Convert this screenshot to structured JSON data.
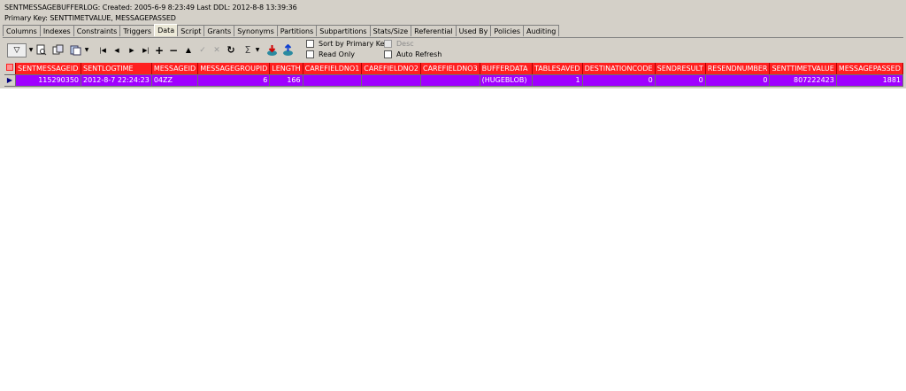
{
  "info": {
    "line1": "SENTMESSAGEBUFFERLOG:  Created: 2005-6-9 8:23:49   Last DDL: 2012-8-8 13:39:36",
    "line2": "Primary Key:  SENTTIMETVALUE, MESSAGEPASSED"
  },
  "tabs": [
    "Columns",
    "Indexes",
    "Constraints",
    "Triggers",
    "Data",
    "Script",
    "Grants",
    "Synonyms",
    "Partitions",
    "Subpartitions",
    "Stats/Size",
    "Referential",
    "Used By",
    "Policies",
    "Auditing"
  ],
  "toolbar": {
    "filter": "▽",
    "first": "|◀",
    "prev": "◀",
    "next": "▶",
    "last": "▶|",
    "insert": "+",
    "delete": "−",
    "up": "▲",
    "post": "✓",
    "cancel": "✕",
    "refresh": "↻",
    "sum": "Σ",
    "options": {
      "sort_by_primary_key": "Sort by Primary Key",
      "desc": "Desc",
      "read_only": "Read Only",
      "auto_refresh": "Auto Refresh"
    }
  },
  "grid": {
    "columns": [
      "SENTMESSAGEID",
      "SENTLOGTIME",
      "MESSAGEID",
      "MESSAGEGROUPID",
      "LENGTH",
      "CAREFIELDNO1",
      "CAREFIELDNO2",
      "CAREFIELDNO3",
      "BUFFERDATA",
      "TABLESAVED",
      "DESTINATIONCODE",
      "SENDRESULT",
      "RESENDNUMBER",
      "SENTTIMETVALUE",
      "MESSAGEPASSED"
    ],
    "row": [
      "115290350",
      "2012-8-7 22:24:23",
      "04ZZ",
      "6",
      "166",
      "",
      "",
      "",
      "(HUGEBLOB)",
      "1",
      "0",
      "0",
      "0",
      "807222423",
      "1881"
    ],
    "row_indicator": "▶",
    "colors": {
      "header_bg": "#ff2020",
      "row_bg": "#a000ff",
      "window_bg": "#d4d0c8"
    }
  }
}
